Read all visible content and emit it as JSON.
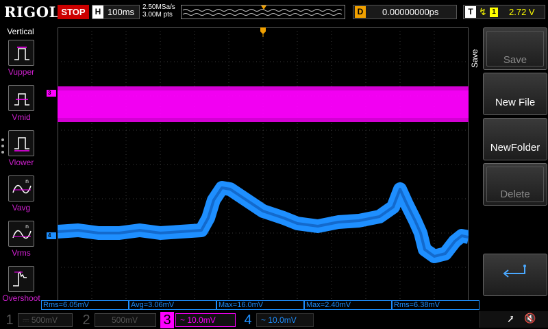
{
  "header": {
    "logo": "RIGOL",
    "run_state": "STOP",
    "horizontal": {
      "label": "H",
      "value": "100ms"
    },
    "sample_rate": "2.50MSa/s",
    "memory_depth": "3.00M pts",
    "delay": {
      "label": "D",
      "value": "0.00000000ps"
    },
    "trigger": {
      "label": "T",
      "edge": "↯",
      "source": "1",
      "level": "2.72 V"
    }
  },
  "measure_panel": {
    "title": "Vertical",
    "items": [
      {
        "label": "Vupper",
        "icon": "vupper-icon"
      },
      {
        "label": "Vmid",
        "icon": "vmid-icon"
      },
      {
        "label": "Vlower",
        "icon": "vlower-icon"
      },
      {
        "label": "Vavg",
        "icon": "vavg-icon"
      },
      {
        "label": "Vrms",
        "icon": "vrms-icon"
      },
      {
        "label": "Overshoot",
        "icon": "overshoot-icon"
      }
    ]
  },
  "menu": {
    "title": "Save",
    "buttons": [
      {
        "label": "Save",
        "enabled": false
      },
      {
        "label": "New File",
        "enabled": true
      },
      {
        "label": "NewFolder",
        "enabled": true
      },
      {
        "label": "Delete",
        "enabled": false
      },
      {
        "label": "",
        "icon": "return-icon",
        "enabled": true
      }
    ]
  },
  "readouts": [
    "Rms=6.05mV",
    "Avg=3.06mV",
    "Max=16.0mV",
    "Max=2.40mV",
    "Rms=6.38mV"
  ],
  "channels": [
    {
      "num": "1",
      "scale": "500mV",
      "coupling": "⎓",
      "active": false
    },
    {
      "num": "2",
      "scale": "500mV",
      "coupling": "",
      "active": false
    },
    {
      "num": "3",
      "scale": "10.0mV",
      "coupling": "~",
      "active": true
    },
    {
      "num": "4",
      "scale": "10.0mV",
      "coupling": "~",
      "active": false
    }
  ],
  "trace_markers": {
    "ch3": "3",
    "ch4": "4"
  },
  "colors": {
    "ch3": "#ff00ff",
    "ch4": "#1e8fff",
    "stop": "#cc0000",
    "trigger": "#f0a000"
  }
}
